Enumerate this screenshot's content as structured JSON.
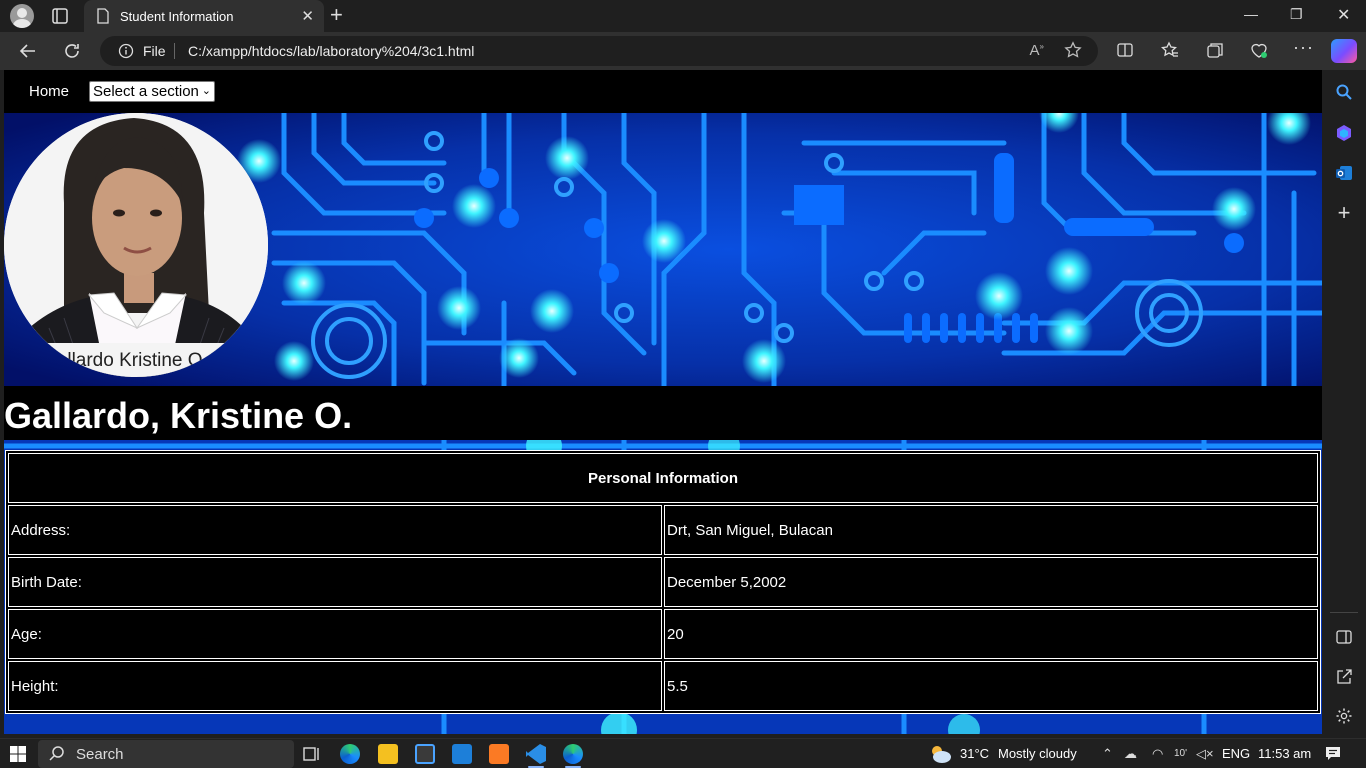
{
  "browser": {
    "tab_title": "Student Information",
    "address_prefix": "File",
    "url": "C:/xampp/htdocs/lab/laboratory%204/3c1.html"
  },
  "page": {
    "nav_home": "Home",
    "section_select_value": "Select a section",
    "photo_caption": "Gallardo Kristine O.",
    "student_name": "Gallardo, Kristine O.",
    "table": {
      "heading": "Personal Information",
      "rows": [
        {
          "label": "Address:",
          "value": "Drt, San Miguel, Bulacan"
        },
        {
          "label": "Birth Date:",
          "value": "December 5,2002"
        },
        {
          "label": "Age:",
          "value": "20"
        },
        {
          "label": "Height:",
          "value": "5.5"
        }
      ]
    }
  },
  "taskbar": {
    "search_label": "Search",
    "weather_temp": "31°C",
    "weather_desc": "Mostly cloudy",
    "language": "ENG",
    "time": "11:53 am"
  },
  "colors": {
    "circuit_dark": "#04126b",
    "circuit_blue": "#0a5cff",
    "circuit_glow": "#3ff4ff"
  }
}
